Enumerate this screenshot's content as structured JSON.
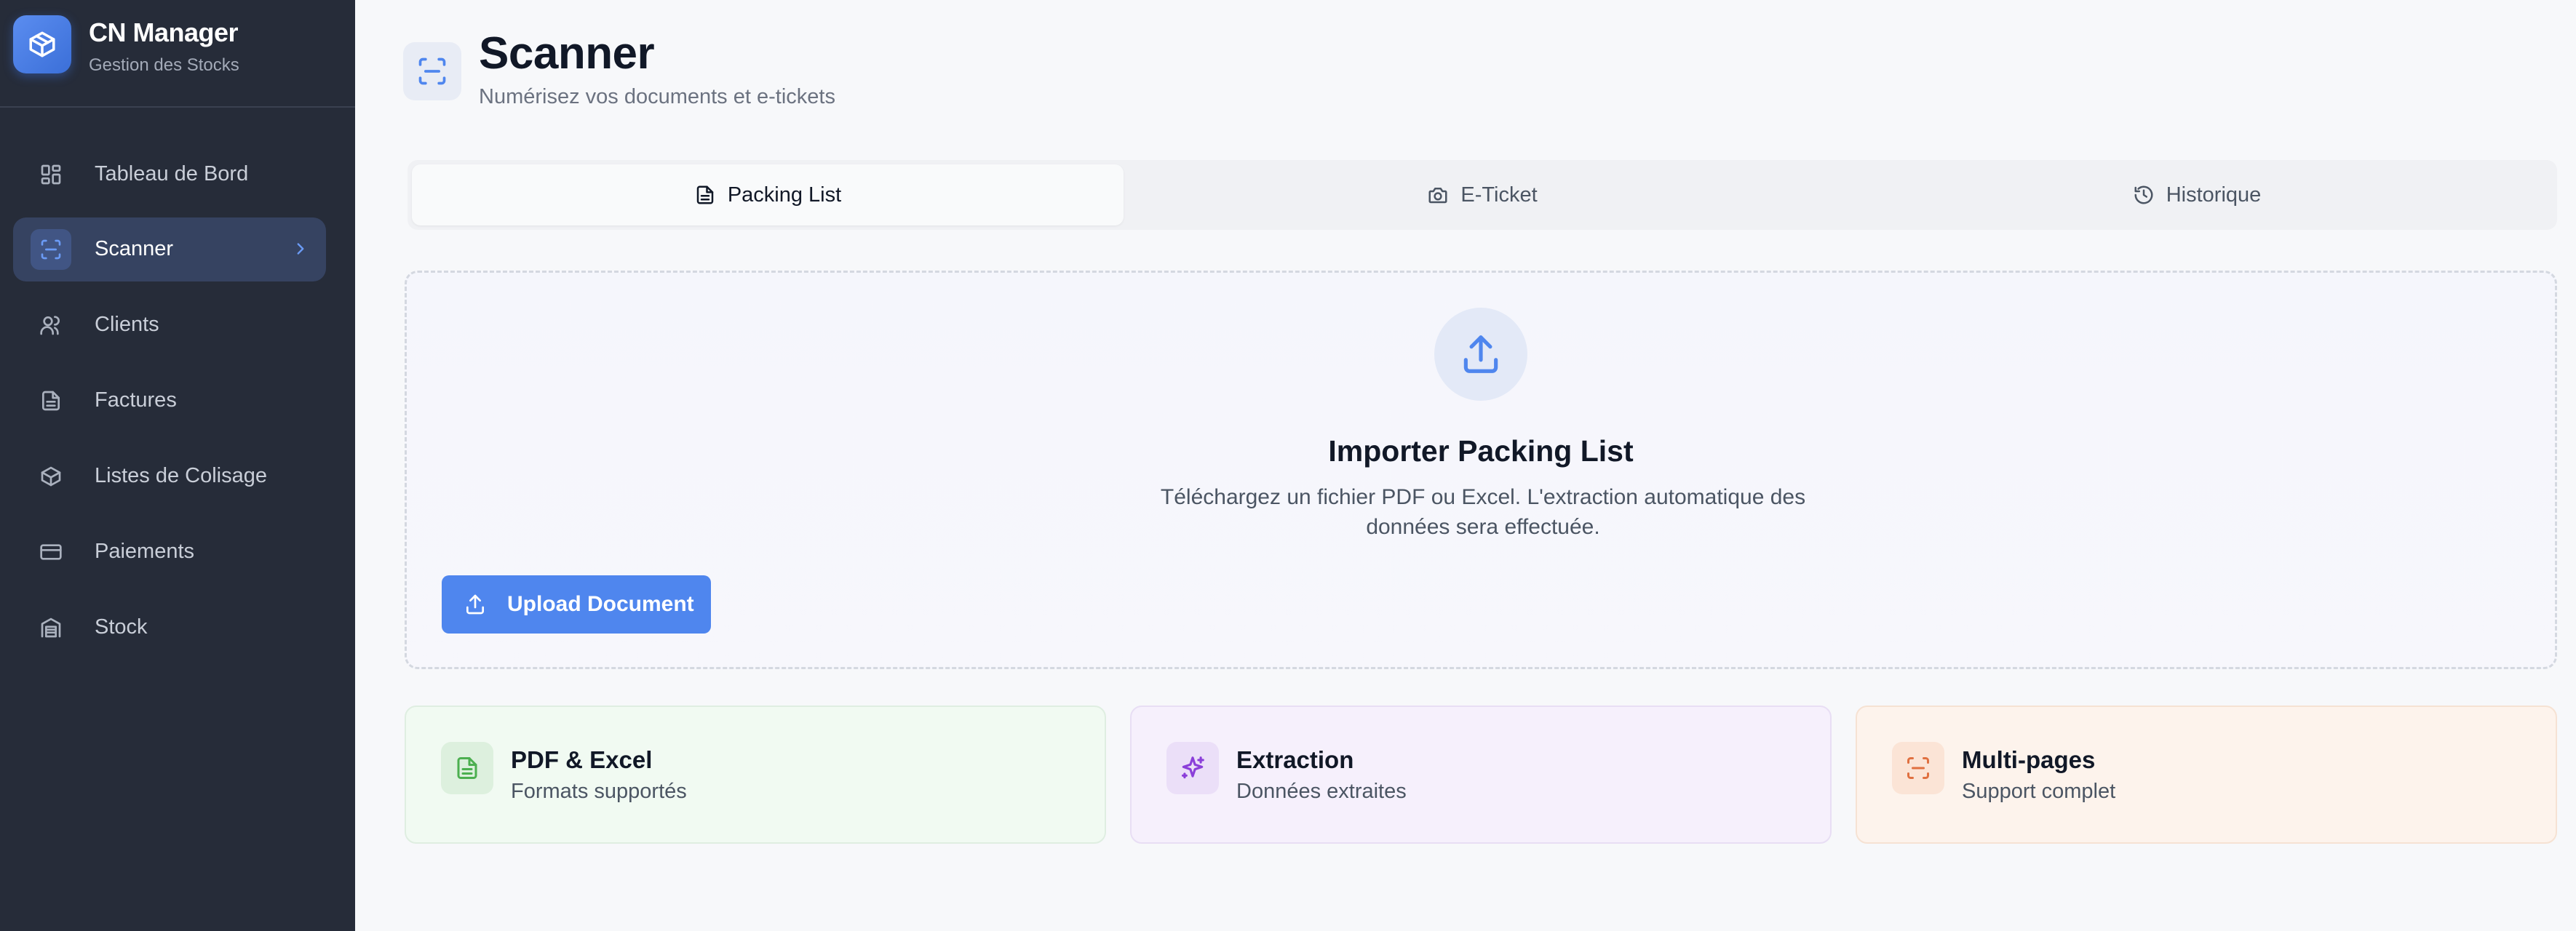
{
  "app": {
    "title": "CN Manager",
    "subtitle": "Gestion des Stocks"
  },
  "sidebar": {
    "items": [
      {
        "label": "Tableau de Bord",
        "icon": "dashboard-icon"
      },
      {
        "label": "Scanner",
        "icon": "scan-icon",
        "active": true
      },
      {
        "label": "Clients",
        "icon": "users-icon"
      },
      {
        "label": "Factures",
        "icon": "document-icon"
      },
      {
        "label": "Listes de Colisage",
        "icon": "package-icon"
      },
      {
        "label": "Paiements",
        "icon": "credit-card-icon"
      },
      {
        "label": "Stock",
        "icon": "warehouse-icon"
      }
    ]
  },
  "header": {
    "title": "Scanner",
    "subtitle": "Numérisez vos documents et e-tickets"
  },
  "tabs": [
    {
      "label": "Packing List",
      "icon": "file-text-icon",
      "active": true
    },
    {
      "label": "E-Ticket",
      "icon": "camera-icon"
    },
    {
      "label": "Historique",
      "icon": "history-icon"
    }
  ],
  "upload": {
    "title": "Importer Packing List",
    "description": "Téléchargez un fichier PDF ou Excel. L'extraction automatique des données sera effectuée.",
    "button_label": "Upload Document"
  },
  "features": [
    {
      "title": "PDF & Excel",
      "subtitle": "Formats supportés",
      "icon": "file-text-icon",
      "color": "#4caf50"
    },
    {
      "title": "Extraction",
      "subtitle": "Données extraites",
      "icon": "sparkles-icon",
      "color": "#8b3fd9"
    },
    {
      "title": "Multi-pages",
      "subtitle": "Support complet",
      "icon": "scan-icon",
      "color": "#e07040"
    }
  ],
  "colors": {
    "sidebar_bg": "#262c39",
    "accent": "#4f86ee",
    "active_nav": "#364361"
  }
}
